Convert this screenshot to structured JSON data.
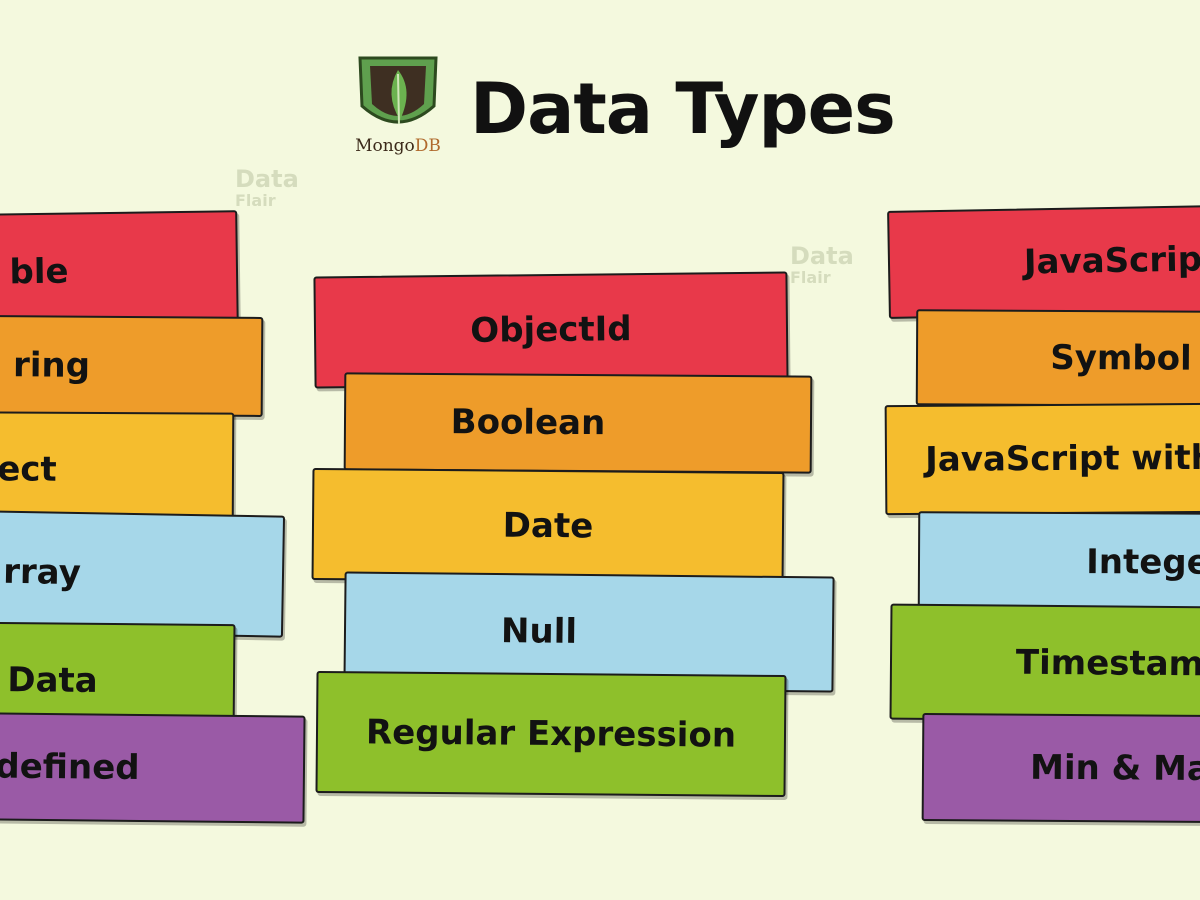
{
  "header": {
    "title": "Data Types",
    "logo_text_mongo": "Mongo",
    "logo_text_db": "DB"
  },
  "watermark": {
    "line1": "Data",
    "line2": "Flair"
  },
  "stacks": {
    "left": [
      "ble",
      "ring",
      "ect",
      "rray",
      "Data",
      "defined"
    ],
    "middle": [
      "ObjectId",
      "Boolean",
      "Date",
      "Null",
      "Regular Expression"
    ],
    "right": [
      "JavaScrip",
      "Symbol",
      "JavaScript with",
      "Intege",
      "Timestam",
      "Min & Ma"
    ]
  },
  "colors": {
    "background": "#f4f9de",
    "red": "#e8394a",
    "orange": "#ee9c2a",
    "yellow": "#f5bd2e",
    "blue": "#a6d7e9",
    "green": "#8ec02b",
    "purple": "#9a5aa6",
    "logo_leaf": "#5fa04e"
  }
}
